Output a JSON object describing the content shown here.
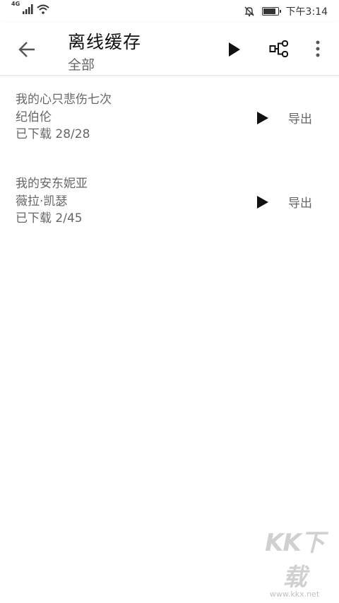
{
  "status_bar": {
    "network": "4G",
    "time": "下午3:14",
    "battery_level": 0.8
  },
  "app_bar": {
    "title": "离线缓存",
    "subtitle": "全部",
    "icons": [
      "back-arrow-icon",
      "play-icon",
      "graph-icon",
      "more-vertical-icon"
    ]
  },
  "items": [
    {
      "title": "我的心只悲伤七次",
      "artist": "纪伯伦",
      "progress": "已下载 28/28",
      "export_label": "导出"
    },
    {
      "title": "我的安东妮亚",
      "artist": "薇拉·凯瑟",
      "progress": "已下载 2/45",
      "export_label": "导出"
    }
  ],
  "watermark": {
    "logo": "KK下载",
    "url": "www.kkx.net"
  }
}
